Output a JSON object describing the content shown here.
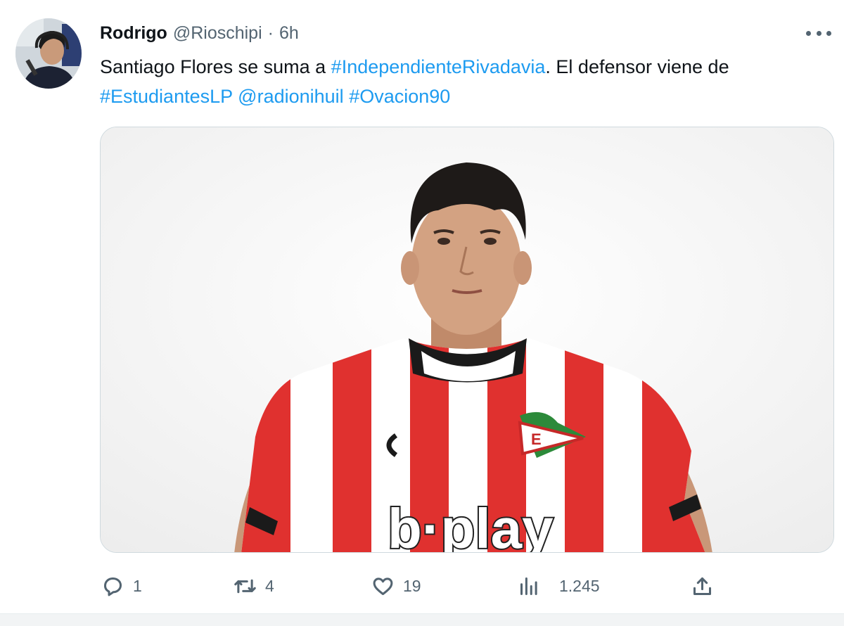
{
  "tweet": {
    "author_name": "Rodrigo",
    "handle": "@Rioschipi",
    "separator": "·",
    "time": "6h",
    "text": {
      "part1": "Santiago Flores se suma a ",
      "hashtag1": "#IndependienteRivadavia",
      "part2": ". El defensor viene de",
      "hashtag2": "#EstudiantesLP",
      "mention": "@radionihuil",
      "hashtag3": "#Ovacion90"
    },
    "media": {
      "sponsor_text": "b·play"
    }
  },
  "actions": {
    "reply_count": "1",
    "retweet_count": "4",
    "like_count": "19",
    "views_count": "1.245"
  },
  "icons": {
    "reply": "reply-icon",
    "retweet": "retweet-icon",
    "like": "heart-icon",
    "views": "views-icon",
    "share": "share-icon",
    "more": "more-icon"
  },
  "colors": {
    "link": "#1d9bf0",
    "secondary_text": "#536471",
    "jersey_red": "#e0312f",
    "jersey_white": "#ffffff"
  }
}
